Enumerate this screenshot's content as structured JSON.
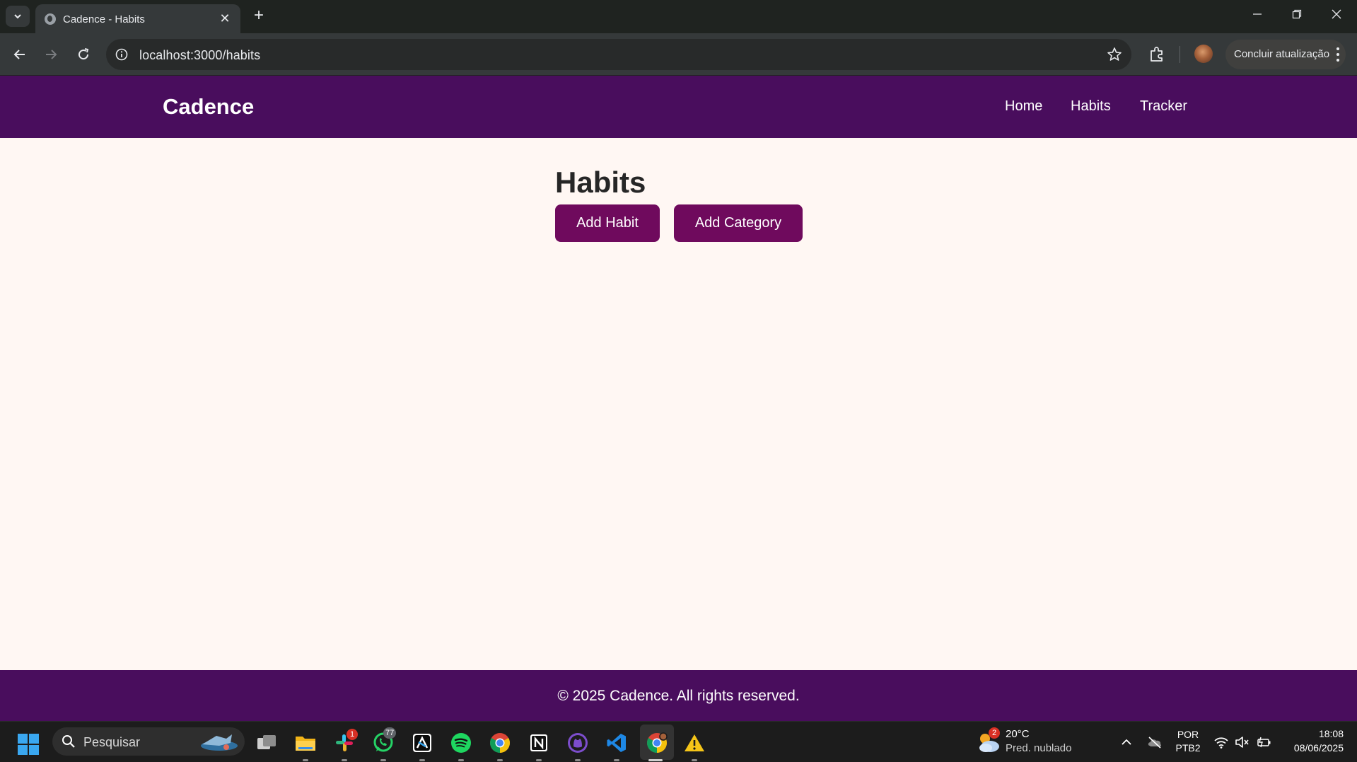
{
  "browser": {
    "tab_title": "Cadence - Habits",
    "url": "localhost:3000/habits",
    "update_button": "Concluir atualização"
  },
  "site": {
    "brand": "Cadence",
    "nav": [
      "Home",
      "Habits",
      "Tracker"
    ],
    "page_title": "Habits",
    "buttons": {
      "add_habit": "Add Habit",
      "add_category": "Add Category"
    },
    "footer": "© 2025 Cadence. All rights reserved."
  },
  "colors": {
    "header_bg": "#490d5d",
    "page_bg": "#fff7f3",
    "button_bg": "#6f0a5d"
  },
  "taskbar": {
    "search_placeholder": "Pesquisar",
    "apps": [
      "task-view-icon",
      "file-explorer-icon",
      "slack-icon",
      "whatsapp-icon",
      "capcut-icon",
      "spotify-icon",
      "chrome-icon",
      "notion-icon",
      "github-desktop-icon",
      "vscode-icon",
      "chrome-profile-icon",
      "warning-icon"
    ],
    "badges": {
      "slack": "1",
      "whatsapp": "77",
      "weather": "2"
    },
    "weather": {
      "temp": "20°C",
      "desc": "Pred. nublado"
    },
    "language": {
      "lang": "POR",
      "layout": "PTB2"
    },
    "clock": {
      "time": "18:08",
      "date": "08/06/2025"
    }
  }
}
